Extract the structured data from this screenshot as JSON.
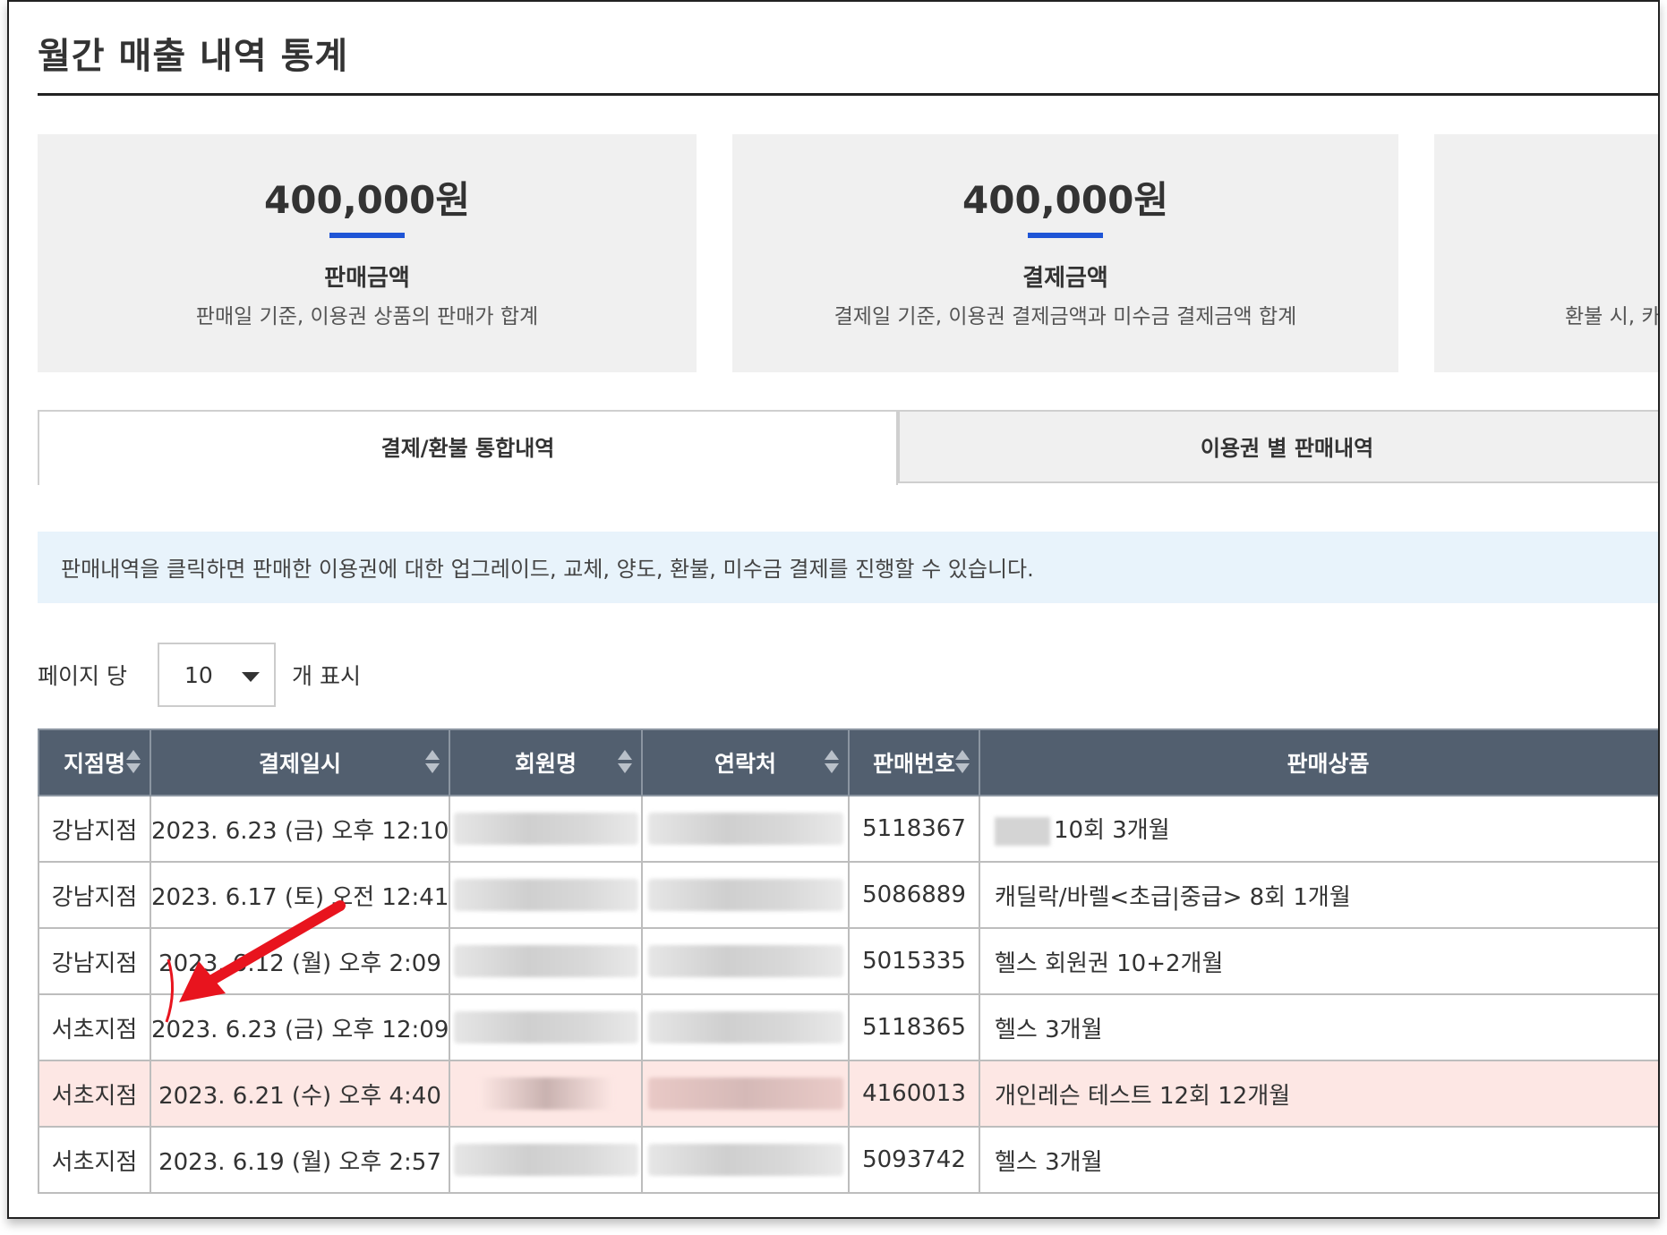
{
  "page": {
    "title": "월간 매출 내역 통계"
  },
  "stats": [
    {
      "amount": "400,000원",
      "label": "판매금액",
      "desc": "판매일 기준, 이용권 상품의 판매가 합계"
    },
    {
      "amount": "400,000원",
      "label": "결제금액",
      "desc": "결제일 기준, 이용권 결제금액과 미수금 결제금액 합계"
    },
    {
      "amount": "",
      "label": "",
      "desc": "환불 시, 카"
    }
  ],
  "tabs": [
    {
      "label": "결제/환불 통합내역",
      "active": true
    },
    {
      "label": "이용권 별 판매내역",
      "active": false
    }
  ],
  "info": {
    "text": "판매내역을 클릭하면 판매한 이용권에 대한 업그레이드, 교체, 양도, 환불, 미수금 결제를 진행할 수 있습니다."
  },
  "pagesize": {
    "prefix": "페이지 당",
    "value": "10",
    "suffix": "개 표시"
  },
  "table": {
    "headers": [
      "지점명",
      "결제일시",
      "회원명",
      "연락처",
      "판매번호",
      "판매상품"
    ],
    "rows": [
      {
        "branch": "강남지점",
        "datetime": "2023. 6.23 (금) 오후 12:10",
        "member": "",
        "phone": "",
        "sale_no": "5118367",
        "product": "10회 3개월",
        "highlight": false
      },
      {
        "branch": "강남지점",
        "datetime": "2023. 6.17 (토) 오전 12:41",
        "member": "",
        "phone": "",
        "sale_no": "5086889",
        "product": "캐딜락/바렐<초급|중급> 8회 1개월",
        "highlight": false
      },
      {
        "branch": "강남지점",
        "datetime": "2023. 6.12 (월) 오후 2:09",
        "member": "",
        "phone": "",
        "sale_no": "5015335",
        "product": "헬스 회원권 10+2개월",
        "highlight": false
      },
      {
        "branch": "서초지점",
        "datetime": "2023. 6.23 (금) 오후 12:09",
        "member": "",
        "phone": "",
        "sale_no": "5118365",
        "product": "헬스 3개월",
        "highlight": false
      },
      {
        "branch": "서초지점",
        "datetime": "2023. 6.21 (수) 오후 4:40",
        "member": "",
        "phone": "",
        "sale_no": "4160013",
        "product": "개인레슨 테스트 12회 12개월",
        "highlight": true
      },
      {
        "branch": "서초지점",
        "datetime": "2023. 6.19 (월) 오후 2:57",
        "member": "",
        "phone": "",
        "sale_no": "5093742",
        "product": "헬스 3개월",
        "highlight": false
      }
    ]
  },
  "colors": {
    "accent": "#1f55d6",
    "header_bg": "#525f6f",
    "highlight_row": "#fde7e4",
    "info_bg": "#e8f3fb",
    "annotation": "#e8141e"
  },
  "annotation": {
    "icon": "red-arrow-icon"
  }
}
